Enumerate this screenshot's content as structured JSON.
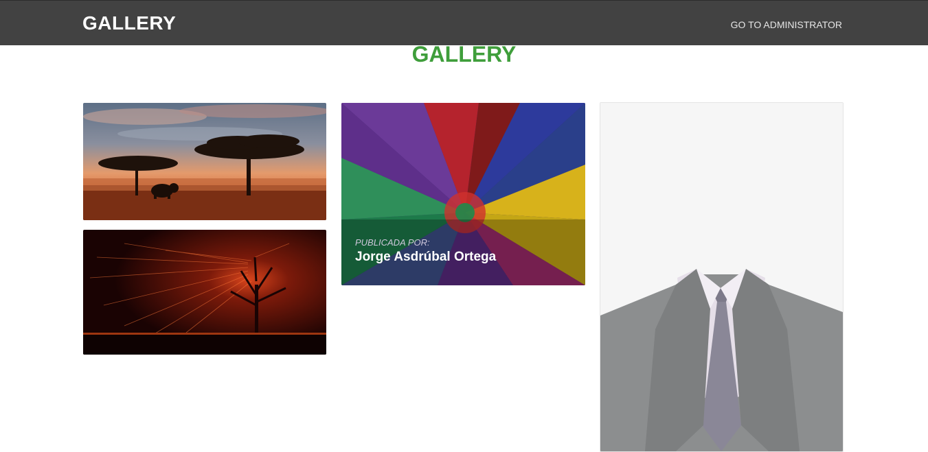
{
  "navbar": {
    "brand": "GALLERY",
    "admin_link": "GO TO ADMINISTRATOR"
  },
  "page": {
    "title": "GALLERY"
  },
  "gallery": {
    "items": [
      {
        "image": "savanna-acacia-elephant-image"
      },
      {
        "image": "burning-tree-night-image"
      },
      {
        "image": "colorful-abstract-swirl-image",
        "caption_label": "PUBLICADA POR:",
        "caption_name": "Jorge Asdrúbal Ortega"
      },
      {
        "image": "suit-and-tie-portrait-image"
      }
    ]
  },
  "colors": {
    "navbar_bg": "#424242",
    "title_green": "#3f9e3b",
    "page_bg": "#ffffff"
  }
}
